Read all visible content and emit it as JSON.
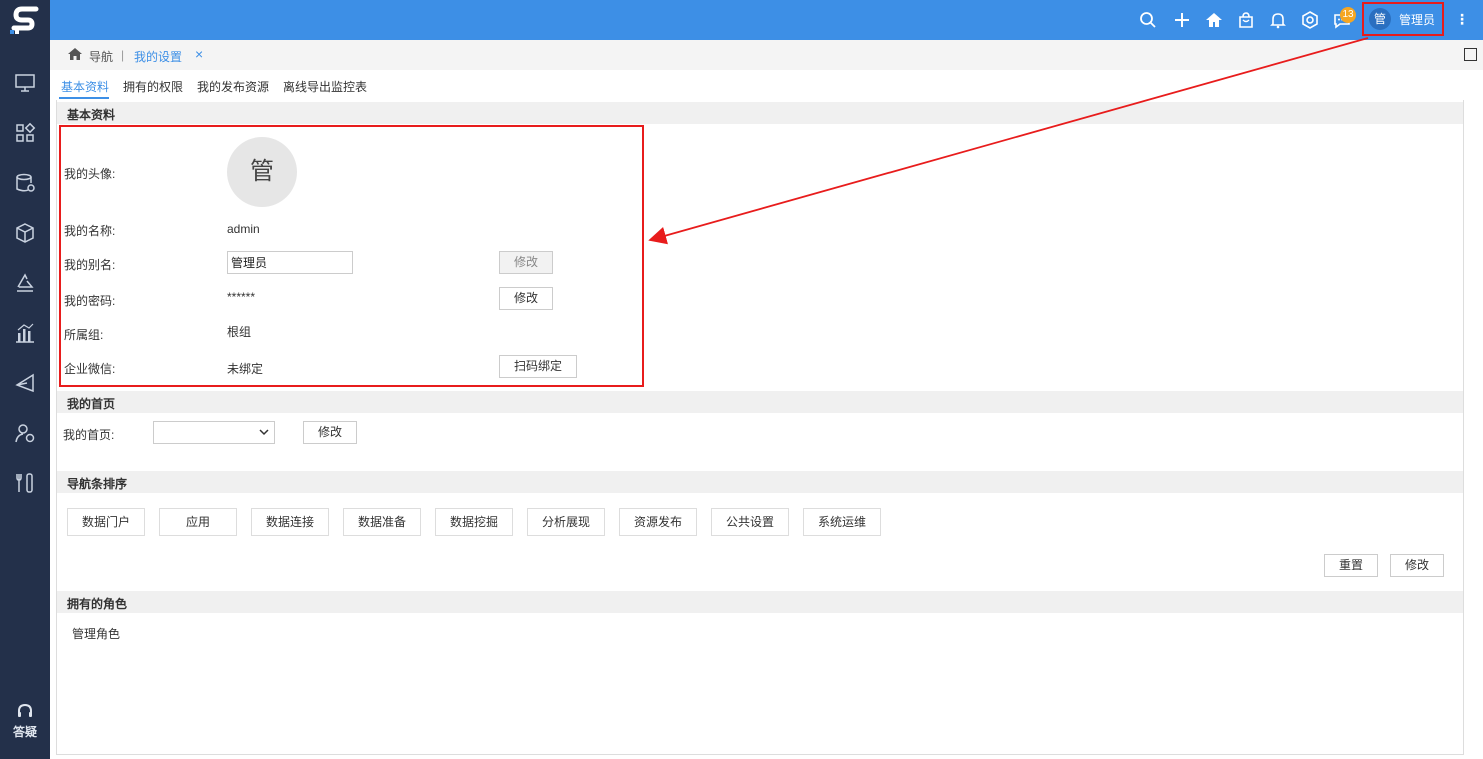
{
  "header": {
    "user_avatar": "管",
    "user_name": "管理员",
    "notification_count": "13",
    "more_glyph": "⋮"
  },
  "sidebar": {
    "help_label": "答疑"
  },
  "breadcrumb": {
    "home_label": "导航",
    "current_label": "我的设置",
    "close_glyph": "×"
  },
  "tabs": [
    {
      "label": "基本资料"
    },
    {
      "label": "拥有的权限"
    },
    {
      "label": "我的发布资源"
    },
    {
      "label": "离线导出监控表"
    }
  ],
  "basic": {
    "section_title": "基本资料",
    "avatar_label": "我的头像:",
    "avatar_char": "管",
    "name_label": "我的名称:",
    "name_value": "admin",
    "alias_label": "我的别名:",
    "alias_value": "管理员",
    "alias_button": "修改",
    "password_label": "我的密码:",
    "password_value": "******",
    "password_button": "修改",
    "group_label": "所属组:",
    "group_value": "根组",
    "wechat_label": "企业微信:",
    "wechat_value": "未绑定",
    "wechat_button": "扫码绑定"
  },
  "homepage": {
    "section_title": "我的首页",
    "label": "我的首页:",
    "selected": "",
    "button": "修改"
  },
  "navorder": {
    "section_title": "导航条排序",
    "items": [
      "数据门户",
      "应用",
      "数据连接",
      "数据准备",
      "数据挖掘",
      "分析展现",
      "资源发布",
      "公共设置",
      "系统运维"
    ],
    "reset_button": "重置",
    "modify_button": "修改"
  },
  "roles": {
    "section_title": "拥有的角色",
    "items": [
      "管理角色"
    ]
  },
  "colors": {
    "topbar": "#3d8fe6",
    "sidebar": "#23304a",
    "highlight": "#e81c1c",
    "badge": "#f5a623"
  }
}
